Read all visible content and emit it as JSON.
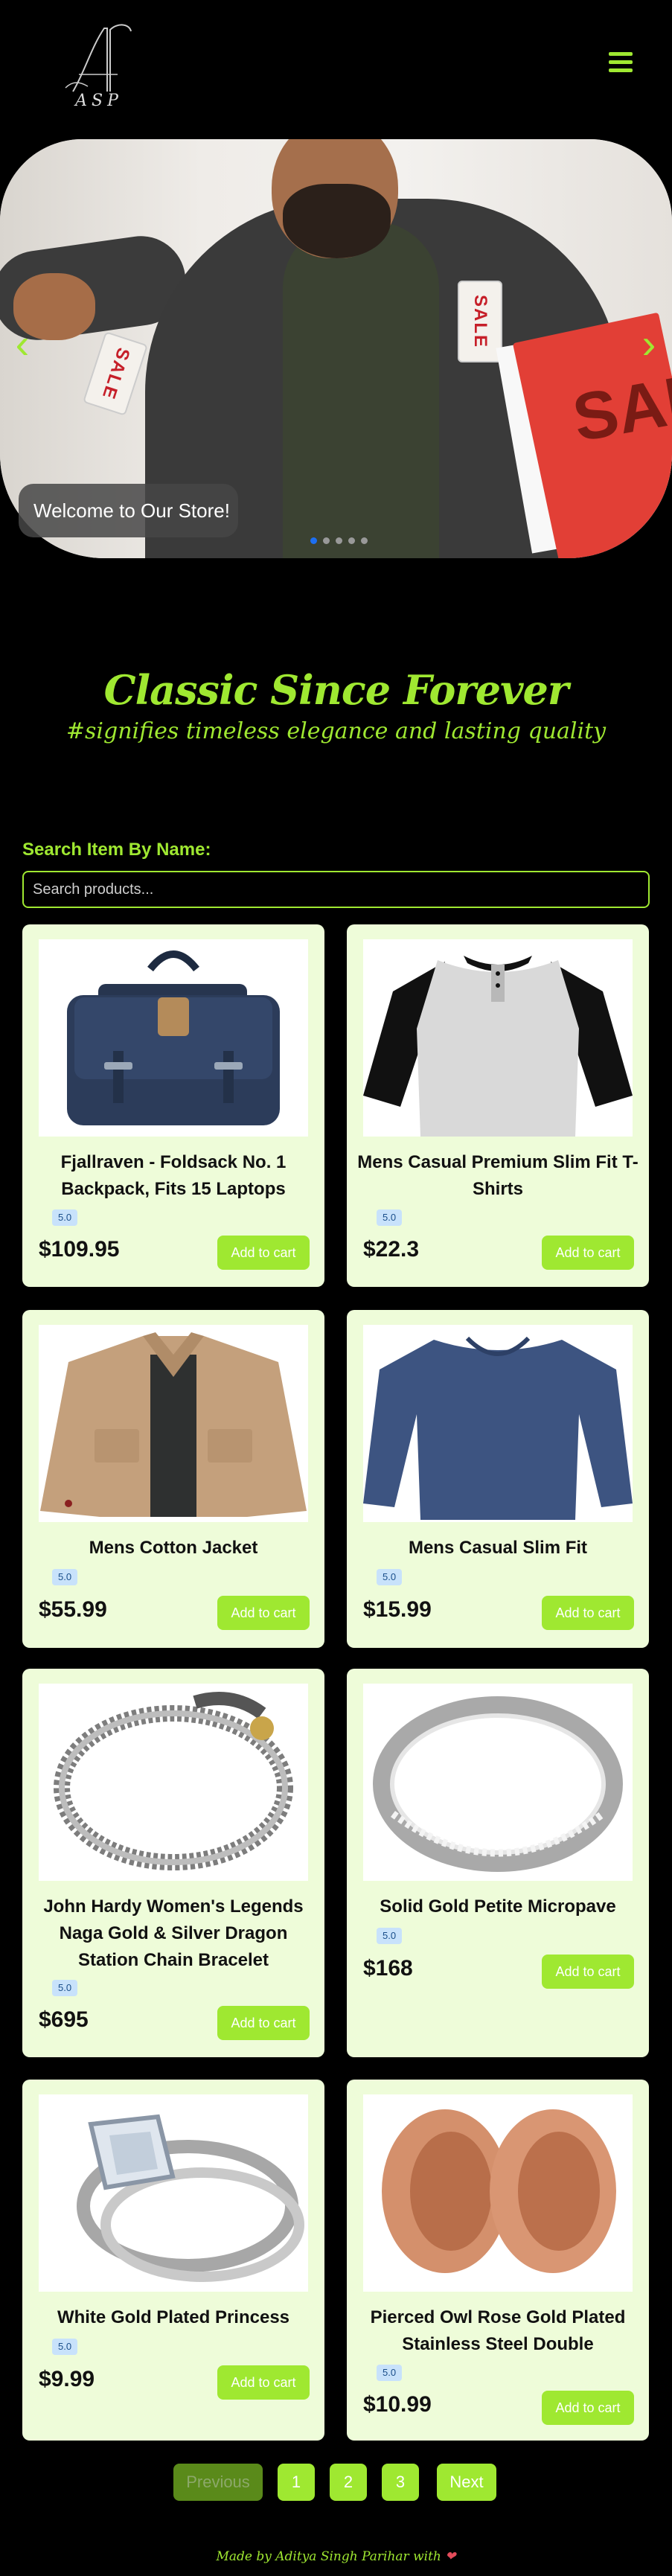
{
  "header": {
    "logo_text": "ASP",
    "menu_icon": "hamburger-icon"
  },
  "hero": {
    "caption": "Welcome to Our Store!",
    "tag_left": "SALE",
    "tag_right": "SALE",
    "bag_text": "SAL",
    "prev_icon": "chevron-left-icon",
    "next_icon": "chevron-right-icon",
    "slide_count": 5,
    "active_slide": 1
  },
  "tagline": {
    "title": "Classic Since Forever",
    "subtitle": "#signifies timeless elegance and lasting quality"
  },
  "search": {
    "label": "Search Item By Name:",
    "placeholder": "Search products..."
  },
  "products": [
    {
      "title": "Fjallraven - Foldsack No. 1 Backpack, Fits 15 Laptops",
      "rating": "5.0",
      "price": "$109.95",
      "button": "Add to cart",
      "image": "backpack"
    },
    {
      "title": "Mens Casual Premium Slim Fit T-Shirts",
      "rating": "5.0",
      "price": "$22.3",
      "button": "Add to cart",
      "image": "raglan-tshirt"
    },
    {
      "title": "Mens Cotton Jacket",
      "rating": "5.0",
      "price": "$55.99",
      "button": "Add to cart",
      "image": "cotton-jacket"
    },
    {
      "title": "Mens Casual Slim Fit",
      "rating": "5.0",
      "price": "$15.99",
      "button": "Add to cart",
      "image": "long-sleeve-shirt"
    },
    {
      "title": "John Hardy Women's Legends Naga Gold & Silver Dragon Station Chain Bracelet",
      "rating": "5.0",
      "price": "$695",
      "button": "Add to cart",
      "image": "dragon-bracelet"
    },
    {
      "title": "Solid Gold Petite Micropave",
      "rating": "5.0",
      "price": "$168",
      "button": "Add to cart",
      "image": "silver-ring"
    },
    {
      "title": "White Gold Plated Princess",
      "rating": "5.0",
      "price": "$9.99",
      "button": "Add to cart",
      "image": "princess-ring"
    },
    {
      "title": "Pierced Owl Rose Gold Plated Stainless Steel Double",
      "rating": "5.0",
      "price": "$10.99",
      "button": "Add to cart",
      "image": "rose-gold-tunnels"
    }
  ],
  "pagination": {
    "previous": "Previous",
    "pages": [
      "1",
      "2",
      "3"
    ],
    "next": "Next"
  },
  "footer": {
    "text": "Made by Aditya Singh Parihar with",
    "heart": "❤"
  },
  "colors": {
    "accent": "#9fe831",
    "card_bg": "#eefcd9",
    "background": "#000000"
  }
}
